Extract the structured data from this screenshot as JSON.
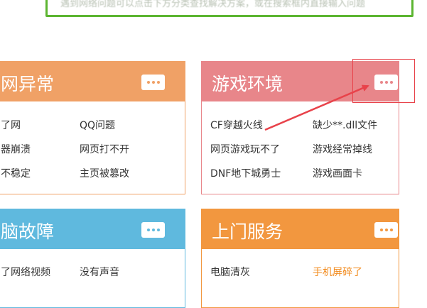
{
  "notice": {
    "text": "遇到网络问题可以点击下方分类查找解决方案，或在搜索框内直接输入问题"
  },
  "colors": {
    "orange_card": "#f0a166",
    "pink_card": "#e8868a",
    "blue_card": "#5fb9de",
    "service_card": "#f2973f",
    "arrow": "#e8424a",
    "green_border": "#5cb531"
  },
  "cards": {
    "network": {
      "title": "网异常",
      "more_icon": "more-dots-icon",
      "links": [
        "了网",
        "QQ问题",
        "器崩溃",
        "网页打不开",
        "不稳定",
        "主页被篡改"
      ]
    },
    "game": {
      "title": "游戏环境",
      "more_icon": "more-dots-icon",
      "links": [
        "CF穿越火线",
        "缺少**.dll文件",
        "网页游戏玩不了",
        "游戏经常掉线",
        "DNF地下城勇士",
        "游戏画面卡"
      ]
    },
    "pc": {
      "title": "脑故障",
      "more_icon": "more-dots-icon",
      "links": [
        "了网络视频",
        "没有声音"
      ]
    },
    "service": {
      "title": "上门服务",
      "more_icon": "more-dots-icon",
      "links": [
        "电脑清灰",
        "手机屏碎了"
      ]
    }
  }
}
